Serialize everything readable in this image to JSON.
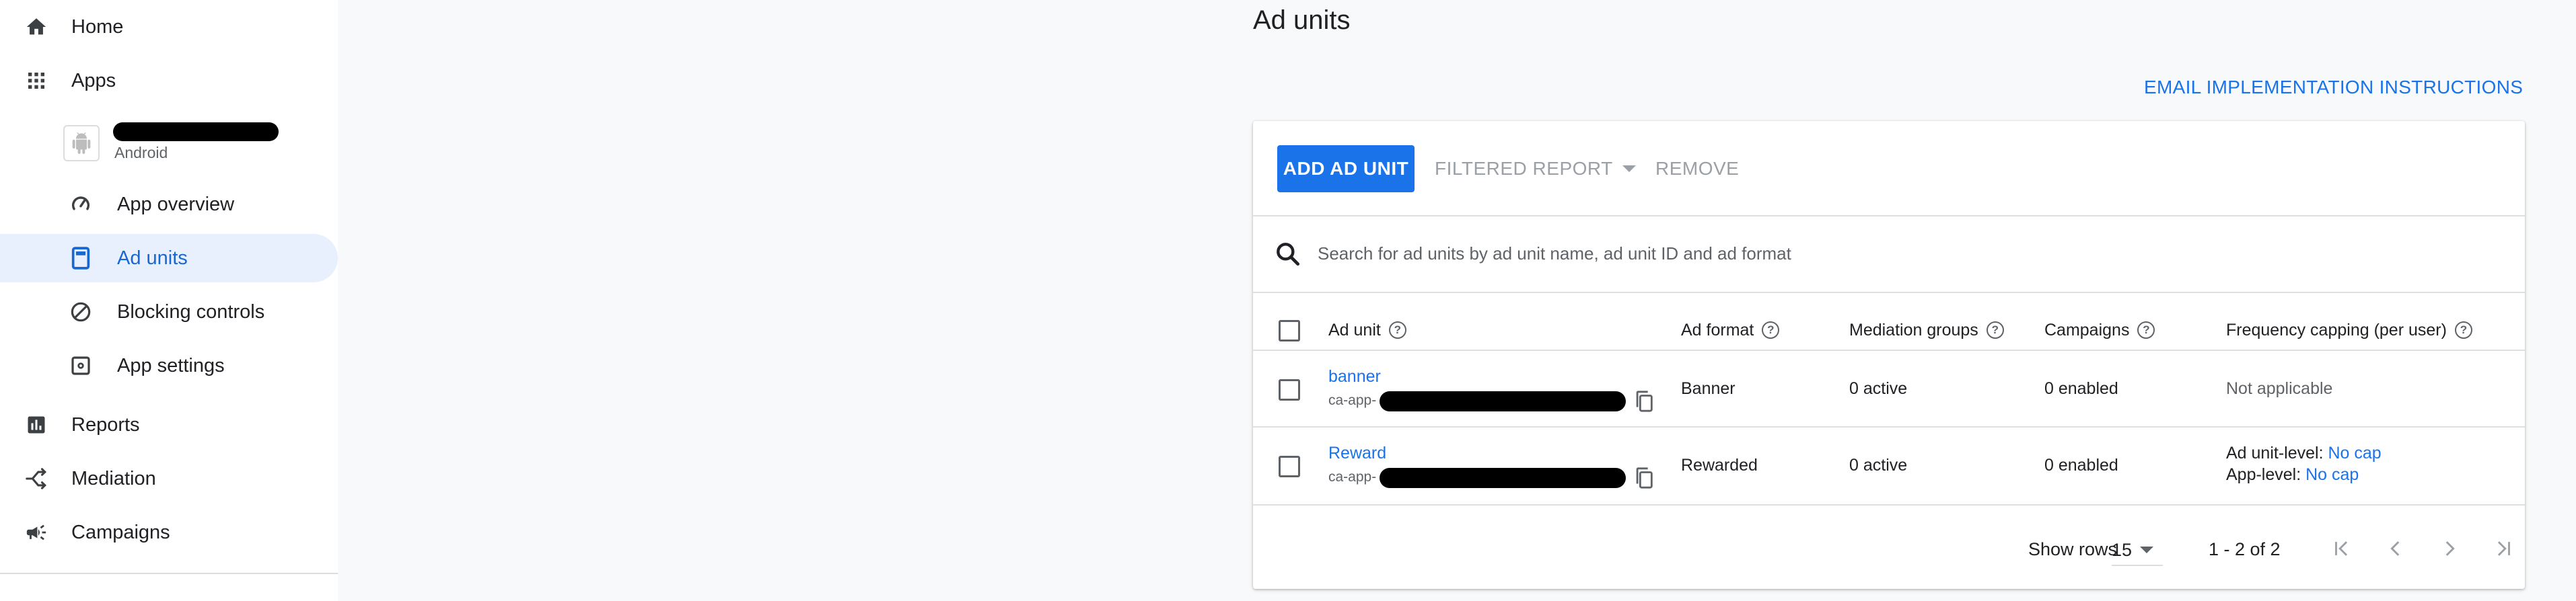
{
  "sidebar": {
    "home_label": "Home",
    "apps_label": "Apps",
    "app": {
      "platform": "Android"
    },
    "app_menu": {
      "overview_label": "App overview",
      "ad_units_label": "Ad units",
      "blocking_label": "Blocking controls",
      "settings_label": "App settings"
    },
    "reports_label": "Reports",
    "mediation_label": "Mediation",
    "campaigns_label": "Campaigns"
  },
  "page": {
    "title": "Ad units",
    "email_link": "EMAIL IMPLEMENTATION INSTRUCTIONS"
  },
  "toolbar": {
    "add_label": "ADD AD UNIT",
    "filtered_report_label": "FILTERED REPORT",
    "remove_label": "REMOVE"
  },
  "search": {
    "placeholder": "Search for ad units by ad unit name, ad unit ID and ad format"
  },
  "table": {
    "headers": {
      "ad_unit": "Ad unit",
      "ad_format": "Ad format",
      "mediation": "Mediation groups",
      "campaigns": "Campaigns",
      "frequency": "Frequency capping (per user)"
    },
    "rows": [
      {
        "name": "banner",
        "id_prefix": "ca-app-",
        "format": "Banner",
        "mediation": "0 active",
        "campaigns": "0 enabled",
        "frequency": "Not applicable"
      },
      {
        "name": "Reward",
        "id_prefix": "ca-app-",
        "format": "Rewarded",
        "mediation": "0 active",
        "campaigns": "0 enabled",
        "freq_unit_label": "Ad unit-level:",
        "freq_unit_value": "No cap",
        "freq_app_label": "App-level:",
        "freq_app_value": "No cap"
      }
    ]
  },
  "footer": {
    "show_rows_label": "Show rows",
    "rows_value": "15",
    "range_label": "1 - 2 of 2"
  },
  "colors": {
    "accent": "#1a73e8",
    "active_nav_bg": "#e8f0fe",
    "disabled_text": "#9aa0a6"
  }
}
